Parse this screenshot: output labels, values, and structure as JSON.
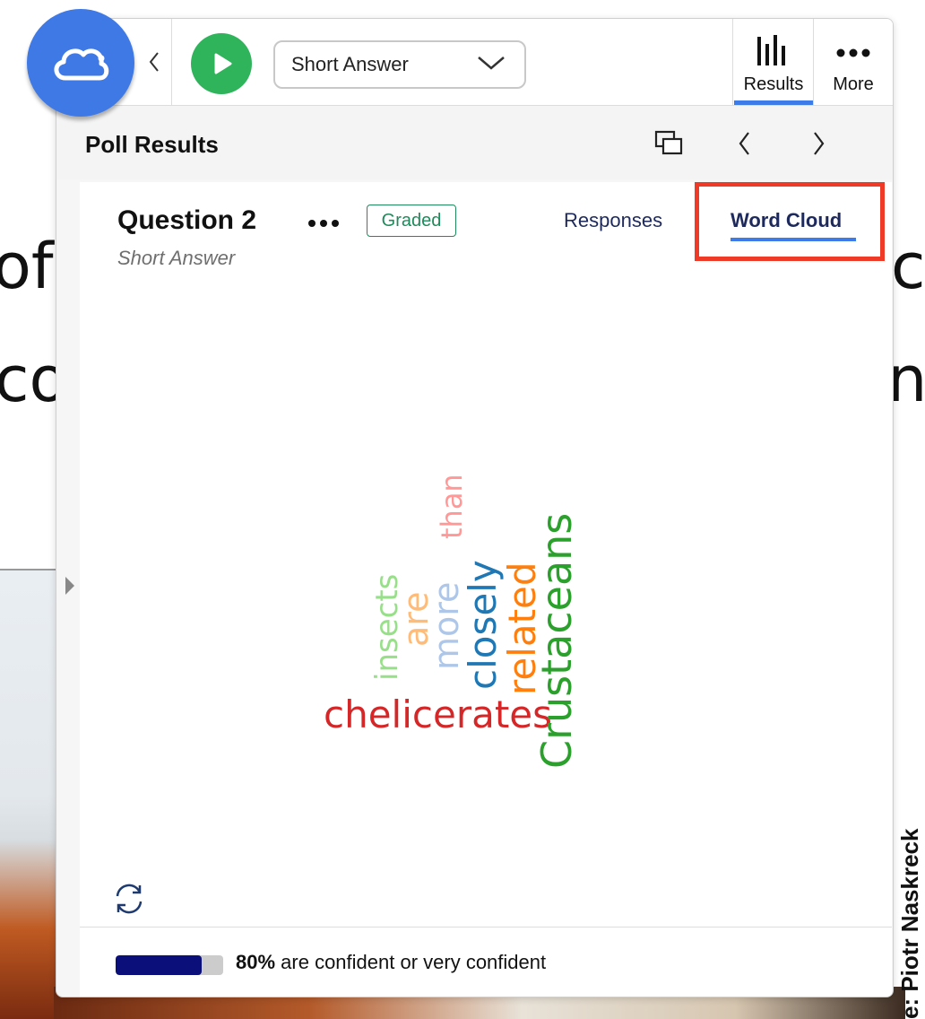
{
  "slide": {
    "text_line1_left": "of",
    "text_line1_right": "c",
    "text_line2_left": "co",
    "text_line2_right": "n",
    "credit": "e: Piotr Naskreck"
  },
  "toolbar": {
    "question_type": "Short Answer",
    "results_label": "Results",
    "more_label": "More"
  },
  "results_header": {
    "title": "Poll Results"
  },
  "question": {
    "title": "Question 2",
    "badge": "Graded",
    "subtitle": "Short Answer",
    "tabs": [
      {
        "label": "Responses"
      },
      {
        "label": "Word Cloud",
        "active": true
      }
    ]
  },
  "word_cloud": {
    "words": [
      {
        "text": "chelicerates",
        "color": "#d62728"
      },
      {
        "text": "Crustaceans",
        "color": "#2ca02c"
      },
      {
        "text": "related",
        "color": "#ff7f0e"
      },
      {
        "text": "closely",
        "color": "#1f77b4"
      },
      {
        "text": "more",
        "color": "#aec7e8"
      },
      {
        "text": "are",
        "color": "#ffbb78"
      },
      {
        "text": "insects",
        "color": "#98df8a"
      },
      {
        "text": "than",
        "color": "#ff9896"
      }
    ]
  },
  "confidence": {
    "percent_value": 80,
    "percent": "80%",
    "text": " are confident or very confident"
  },
  "colors": {
    "accent": "#3d7be8",
    "play": "#2fb35b",
    "logo": "#3e79e6",
    "highlight": "#f03a28",
    "graded": "#1f8a5b",
    "confidence_fill": "#0b0f7a"
  }
}
